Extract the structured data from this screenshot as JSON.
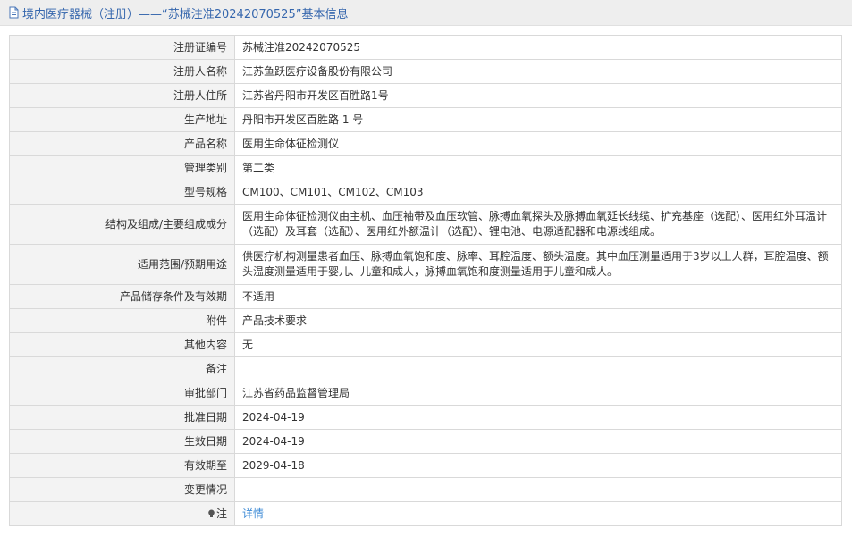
{
  "header": {
    "title": "境内医疗器械（注册）——“苏械注准20242070525”基本信息",
    "icon": "document-icon"
  },
  "rows": [
    {
      "label": "注册证编号",
      "value": "苏械注准20242070525"
    },
    {
      "label": "注册人名称",
      "value": "江苏鱼跃医疗设备股份有限公司"
    },
    {
      "label": "注册人住所",
      "value": "江苏省丹阳市开发区百胜路1号"
    },
    {
      "label": "生产地址",
      "value": "丹阳市开发区百胜路 1 号"
    },
    {
      "label": "产品名称",
      "value": "医用生命体征检测仪"
    },
    {
      "label": "管理类别",
      "value": "第二类"
    },
    {
      "label": "型号规格",
      "value": "CM100、CM101、CM102、CM103"
    },
    {
      "label": "结构及组成/主要组成成分",
      "value": "医用生命体征检测仪由主机、血压袖带及血压软管、脉搏血氧探头及脉搏血氧延长线缆、扩充基座（选配）、医用红外耳温计（选配）及耳套（选配）、医用红外额温计（选配）、锂电池、电源适配器和电源线组成。"
    },
    {
      "label": "适用范围/预期用途",
      "value": "供医疗机构测量患者血压、脉搏血氧饱和度、脉率、耳腔温度、额头温度。其中血压测量适用于3岁以上人群，耳腔温度、额头温度测量适用于婴儿、儿童和成人，脉搏血氧饱和度测量适用于儿童和成人。"
    },
    {
      "label": "产品储存条件及有效期",
      "value": "不适用"
    },
    {
      "label": "附件",
      "value": "产品技术要求"
    },
    {
      "label": "其他内容",
      "value": "无"
    },
    {
      "label": "备注",
      "value": ""
    },
    {
      "label": "审批部门",
      "value": "江苏省药品监督管理局"
    },
    {
      "label": "批准日期",
      "value": "2024-04-19"
    },
    {
      "label": "生效日期",
      "value": "2024-04-19"
    },
    {
      "label": "有效期至",
      "value": "2029-04-18"
    },
    {
      "label": "变更情况",
      "value": ""
    }
  ],
  "note": {
    "label": "注",
    "icon": "lightbulb-icon",
    "link_text": "详情",
    "link_color": "#3e8bd6"
  }
}
